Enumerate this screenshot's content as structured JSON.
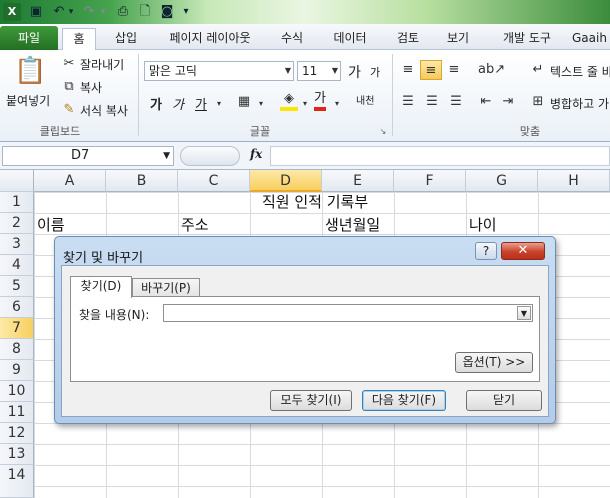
{
  "window": {
    "quick_access": {
      "undo": "↶",
      "redo": "↷",
      "dropdown": "▾"
    }
  },
  "tabs": {
    "file": "파일",
    "home": "홈",
    "insert": "삽입",
    "page_layout": "페이지 레이아웃",
    "formulas": "수식",
    "data": "데이터",
    "review": "검토",
    "view": "보기",
    "developer": "개발 도구",
    "addin": "Gaaih"
  },
  "ribbon": {
    "clipboard": {
      "paste": "붙여넣기",
      "cut": "잘라내기",
      "copy": "복사",
      "format_painter": "서식 복사",
      "label": "클립보드"
    },
    "font": {
      "name": "맑은 고딕",
      "size": "11",
      "grow": "가",
      "shrink": "가",
      "bold": "가",
      "italic": "가",
      "underline": "가",
      "font_color_glyph": "가",
      "phonetic": "내천",
      "label": "글꼴"
    },
    "alignment": {
      "wrap_text": "텍스트 줄 바",
      "merge_center": "병합하고 가",
      "label": "맞춤"
    }
  },
  "formula_bar": {
    "name_box": "D7",
    "fx": "fx"
  },
  "sheet": {
    "columns": [
      "A",
      "B",
      "C",
      "D",
      "E",
      "F",
      "G",
      "H"
    ],
    "selected_column": "D",
    "rows": [
      "1",
      "2",
      "3",
      "4",
      "5",
      "6",
      "7",
      "8",
      "9",
      "10",
      "11",
      "12",
      "13",
      "14"
    ],
    "selected_row": "7",
    "cells": {
      "title": "직원 인적 기록부",
      "a2": "이름",
      "c2": "주소",
      "e2": "생년월일",
      "g2": "나이"
    }
  },
  "dialog": {
    "title": "찾기 및 바꾸기",
    "help": "?",
    "close": "✕",
    "tab_find": "찾기(D)",
    "tab_replace": "바꾸기(P)",
    "find_label": "찾을 내용(N):",
    "find_value": "",
    "options_button": "옵션(T) >>",
    "find_all": "모두 찾기(I)",
    "find_next": "다음 찾기(F)",
    "close_button": "닫기"
  }
}
